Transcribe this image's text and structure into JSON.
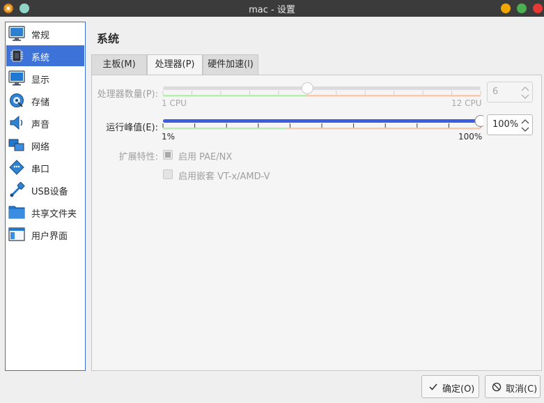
{
  "window": {
    "title": "mac - 设置"
  },
  "sidebar": {
    "items": [
      {
        "label": "常规",
        "icon": "general-monitor-icon",
        "selected": false
      },
      {
        "label": "系统",
        "icon": "chip-icon",
        "selected": true
      },
      {
        "label": "显示",
        "icon": "display-monitor-icon",
        "selected": false
      },
      {
        "label": "存储",
        "icon": "disk-icon",
        "selected": false
      },
      {
        "label": "声音",
        "icon": "speaker-icon",
        "selected": false
      },
      {
        "label": "网络",
        "icon": "network-icon",
        "selected": false
      },
      {
        "label": "串口",
        "icon": "serial-port-icon",
        "selected": false
      },
      {
        "label": "USB设备",
        "icon": "usb-icon",
        "selected": false
      },
      {
        "label": "共享文件夹",
        "icon": "folder-icon",
        "selected": false
      },
      {
        "label": "用户界面",
        "icon": "window-ui-icon",
        "selected": false
      }
    ]
  },
  "main": {
    "title": "系统",
    "tabs": [
      {
        "label": "主板(M)",
        "active": false
      },
      {
        "label": "处理器(P)",
        "active": true
      },
      {
        "label": "硬件加速(l)",
        "active": false
      }
    ]
  },
  "processor": {
    "count_label": "处理器数量(P):",
    "count_value": "6",
    "count_enabled": false,
    "count_min_label": "1 CPU",
    "count_max_label": "12 CPU",
    "count_min": 1,
    "count_max": 12,
    "count_slider_value": 6,
    "cap_label": "运行峰值(E):",
    "cap_value": "100%",
    "cap_min_label": "1%",
    "cap_max_label": "100%",
    "cap_min": 1,
    "cap_max": 100,
    "cap_slider_value": 100,
    "ext_label": "扩展特性:",
    "pae_label": "启用 PAE/NX",
    "pae_checked": true,
    "vtx_label": "启用嵌套 VT-x/AMD-V",
    "vtx_checked": false
  },
  "buttons": {
    "ok_label": "确定(O)",
    "cancel_label": "取消(C)"
  },
  "colors": {
    "accent": "#3d72d8",
    "slider_fill": "#3b5fe0",
    "good_zone": "#b9ecb0",
    "warn_zone": "#f6c9b0",
    "titlebar": "#3b3b3b"
  }
}
